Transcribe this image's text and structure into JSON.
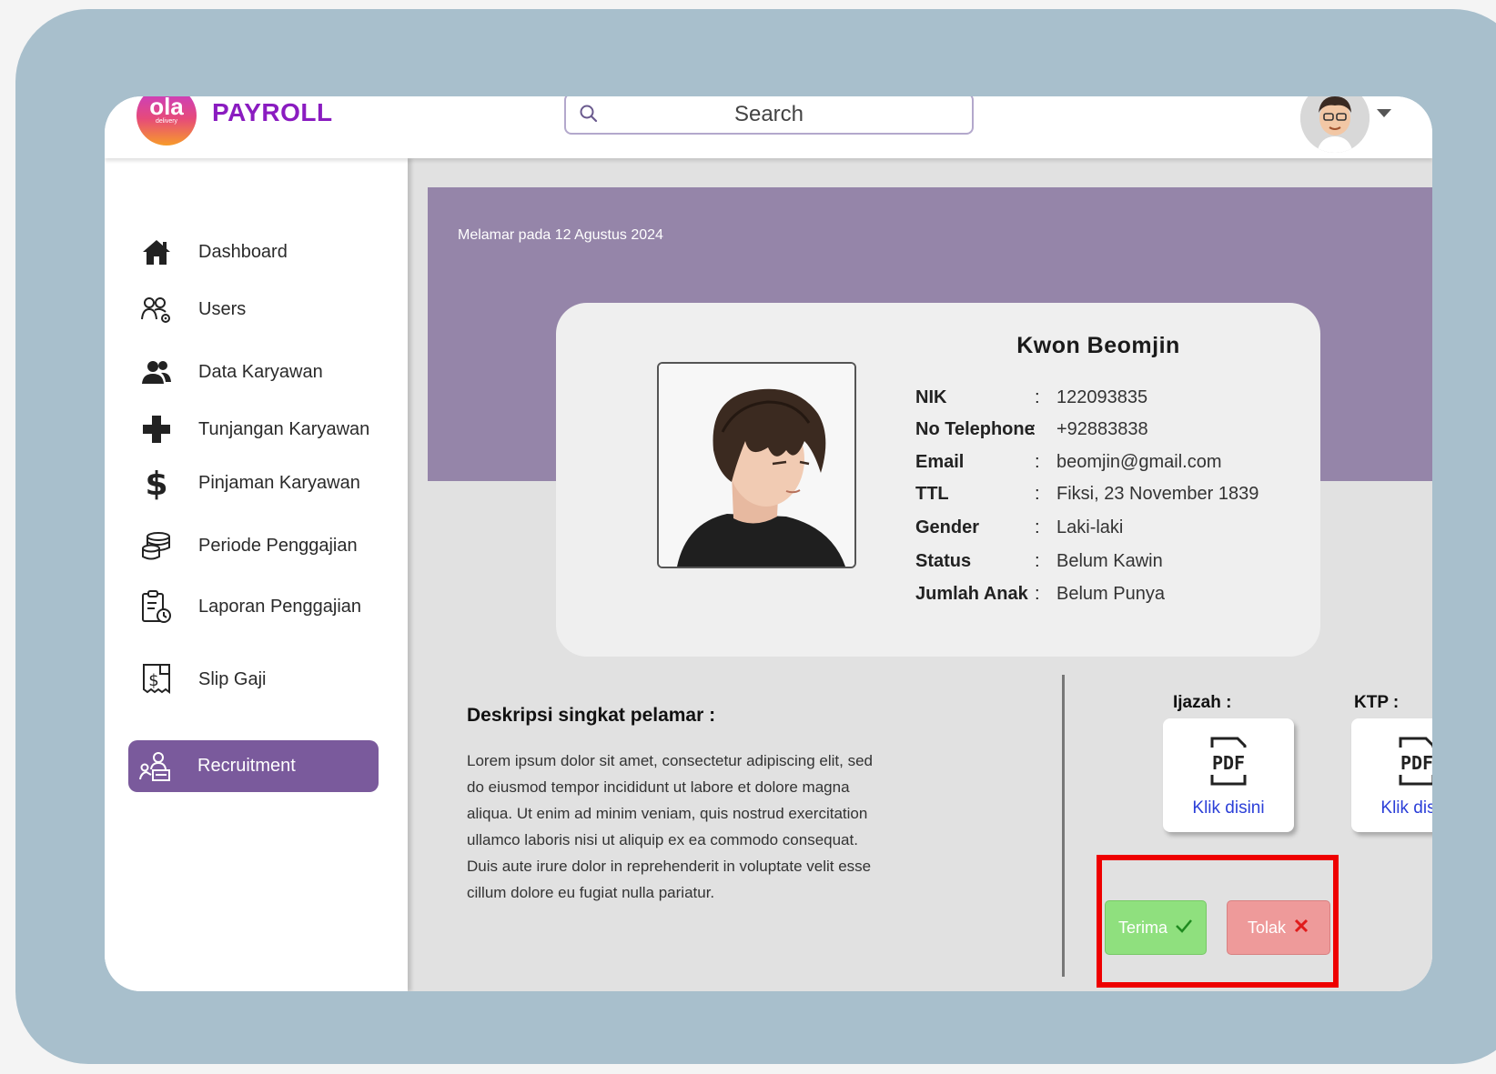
{
  "header": {
    "logo_text": "ola",
    "logo_sub": "delivery",
    "brand": "PAYROLL",
    "search_placeholder": "Search"
  },
  "sidebar": {
    "items": [
      {
        "label": "Dashboard",
        "icon": "home-icon"
      },
      {
        "label": "Users",
        "icon": "users-gear-icon"
      },
      {
        "label": "Data Karyawan",
        "icon": "people-icon"
      },
      {
        "label": "Tunjangan Karyawan",
        "icon": "plus-icon"
      },
      {
        "label": "Pinjaman Karyawan",
        "icon": "dollar-icon"
      },
      {
        "label": "Periode Penggajian",
        "icon": "coins-icon"
      },
      {
        "label": "Laporan Penggajian",
        "icon": "report-clock-icon"
      },
      {
        "label": "Slip Gaji",
        "icon": "receipt-icon"
      },
      {
        "label": "Recruitment",
        "icon": "recruitment-icon",
        "active": true
      }
    ]
  },
  "applicant": {
    "applied_on": "Melamar pada 12 Agustus 2024",
    "name": "Kwon Beomjin",
    "fields": [
      {
        "label": "NIK",
        "value": "122093835"
      },
      {
        "label": "No Telephone",
        "value": "+92883838"
      },
      {
        "label": "Email",
        "value": "beomjin@gmail.com"
      },
      {
        "label": "TTL",
        "value": "Fiksi, 23 November 1839"
      },
      {
        "label": "Gender",
        "value": "Laki-laki"
      },
      {
        "label": "Status",
        "value": "Belum Kawin"
      },
      {
        "label": "Jumlah Anak",
        "value": "Belum Punya"
      }
    ],
    "separator": ":"
  },
  "description": {
    "title": "Deskripsi singkat pelamar :",
    "body": "Lorem ipsum dolor sit amet, consectetur adipiscing elit, sed do eiusmod tempor incididunt ut labore et dolore magna aliqua. Ut enim ad minim veniam, quis nostrud exercitation ullamco laboris nisi ut aliquip ex ea commodo consequat. Duis aute irure dolor in reprehenderit in voluptate velit esse cillum dolore eu fugiat nulla pariatur."
  },
  "documents": {
    "ijazah_label": "Ijazah :",
    "ktp_label": "KTP :",
    "pdf_text": "PDF",
    "link_text": "Klik disini"
  },
  "actions": {
    "accept": "Terima",
    "reject": "Tolak"
  },
  "colors": {
    "brand": "#8a1cc0",
    "active_nav": "#7a5a9c",
    "banner": "#9585a9",
    "accept": "#8fe07e",
    "reject": "#ee9a9a",
    "highlight": "#ee0000"
  }
}
